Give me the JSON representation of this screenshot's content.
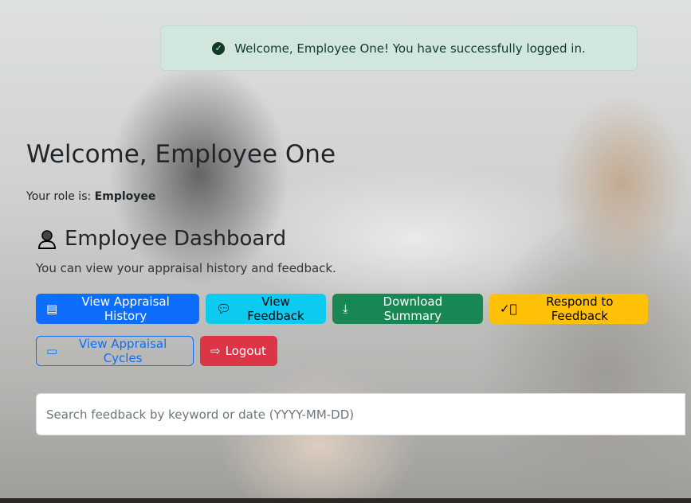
{
  "toast": {
    "message": "Welcome, Employee One! You have successfully logged in.",
    "icon": "check-circle-icon"
  },
  "header": {
    "title": "Welcome, Employee One",
    "role_label": "Your role is:",
    "role": "Employee"
  },
  "dashboard": {
    "title": "Employee Dashboard",
    "subtitle": "You can view your appraisal history and feedback."
  },
  "buttons": {
    "history": "View Appraisal History",
    "feedback": "View Feedback",
    "download": "Download Summary",
    "respond": "Respond to Feedback",
    "cycles": "View Appraisal Cycles",
    "logout": "Logout"
  },
  "search": {
    "placeholder": "Search feedback by keyword or date (YYYY-MM-DD)",
    "value": ""
  },
  "colors": {
    "primary": "#0d6efd",
    "info": "#0dcaf0",
    "success": "#198754",
    "warning": "#ffc107",
    "danger": "#dc3545"
  }
}
